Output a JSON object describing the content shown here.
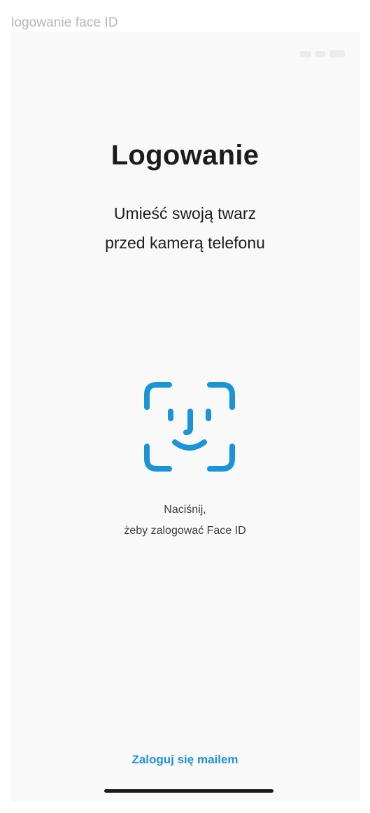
{
  "frame": {
    "label": "logowanie face ID"
  },
  "screen": {
    "title": "Logowanie",
    "subtitle_line1": "Umieść swoją twarz",
    "subtitle_line2": "przed kamerą telefonu",
    "hint_line1": "Naciśnij,",
    "hint_line2": "żeby zalogować Face ID",
    "email_login_label": "Zaloguj się mailem"
  },
  "icons": {
    "face_id": "face-id-icon"
  },
  "colors": {
    "accent": "#1a93d8",
    "text": "#1c1c1c",
    "background": "#f9f9f9"
  }
}
